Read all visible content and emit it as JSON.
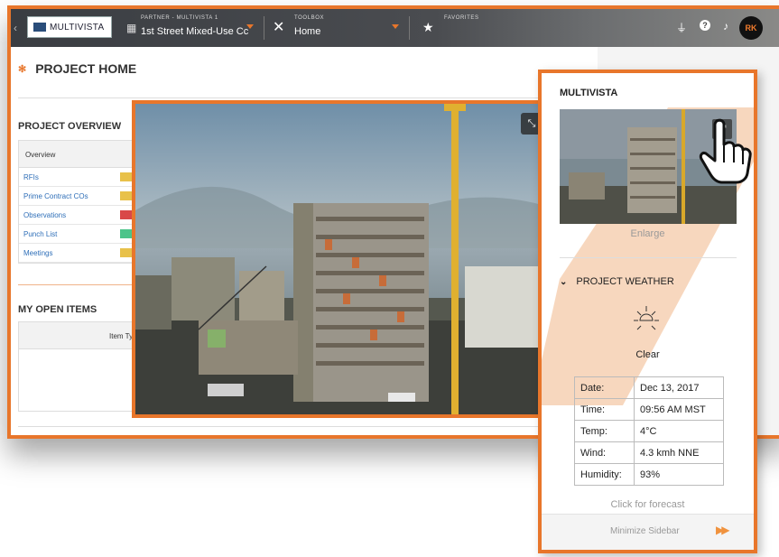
{
  "topbar": {
    "logo_text": "MULTIVISTA",
    "partner_label": "PARTNER - MULTIVISTA 1",
    "project_name": "1st Street Mixed-Use Cc",
    "toolbox_label": "TOOLBOX",
    "toolbox_value": "Home",
    "favorites_label": "FAVORITES",
    "avatar_initials": "RK",
    "icons": [
      "plug-icon",
      "help-icon",
      "bell-icon"
    ]
  },
  "page": {
    "title": "PROJECT HOME",
    "overview_title": "PROJECT OVERVIEW",
    "overview_header": "Overview",
    "overview_rows": [
      {
        "label": "RFIs",
        "color": "#e8c14a"
      },
      {
        "label": "Prime Contract COs",
        "color": "#e8c14a"
      },
      {
        "label": "Observations",
        "color": "#d94848"
      },
      {
        "label": "Punch List",
        "color": "#4cc48a"
      },
      {
        "label": "Meetings",
        "color": "#e8c14a"
      }
    ],
    "open_items_title": "MY OPEN ITEMS",
    "open_items_header": "Item Ty"
  },
  "sidebar": {
    "brand": "MULTIVISTA",
    "enlarge_label": "Enlarge",
    "weather_title": "PROJECT WEATHER",
    "condition": "Clear",
    "weather_rows": [
      {
        "label": "Date:",
        "value": "Dec 13, 2017"
      },
      {
        "label": "Time:",
        "value": "09:56 AM MST"
      },
      {
        "label": "Temp:",
        "value": "4°C"
      },
      {
        "label": "Wind:",
        "value": "4.3 kmh NNE"
      },
      {
        "label": "Humidity:",
        "value": "93%"
      }
    ],
    "forecast_link": "Click for forecast",
    "minimize_label": "Minimize Sidebar"
  },
  "colors": {
    "accent": "#e8762b",
    "link": "#2f6fb8"
  }
}
